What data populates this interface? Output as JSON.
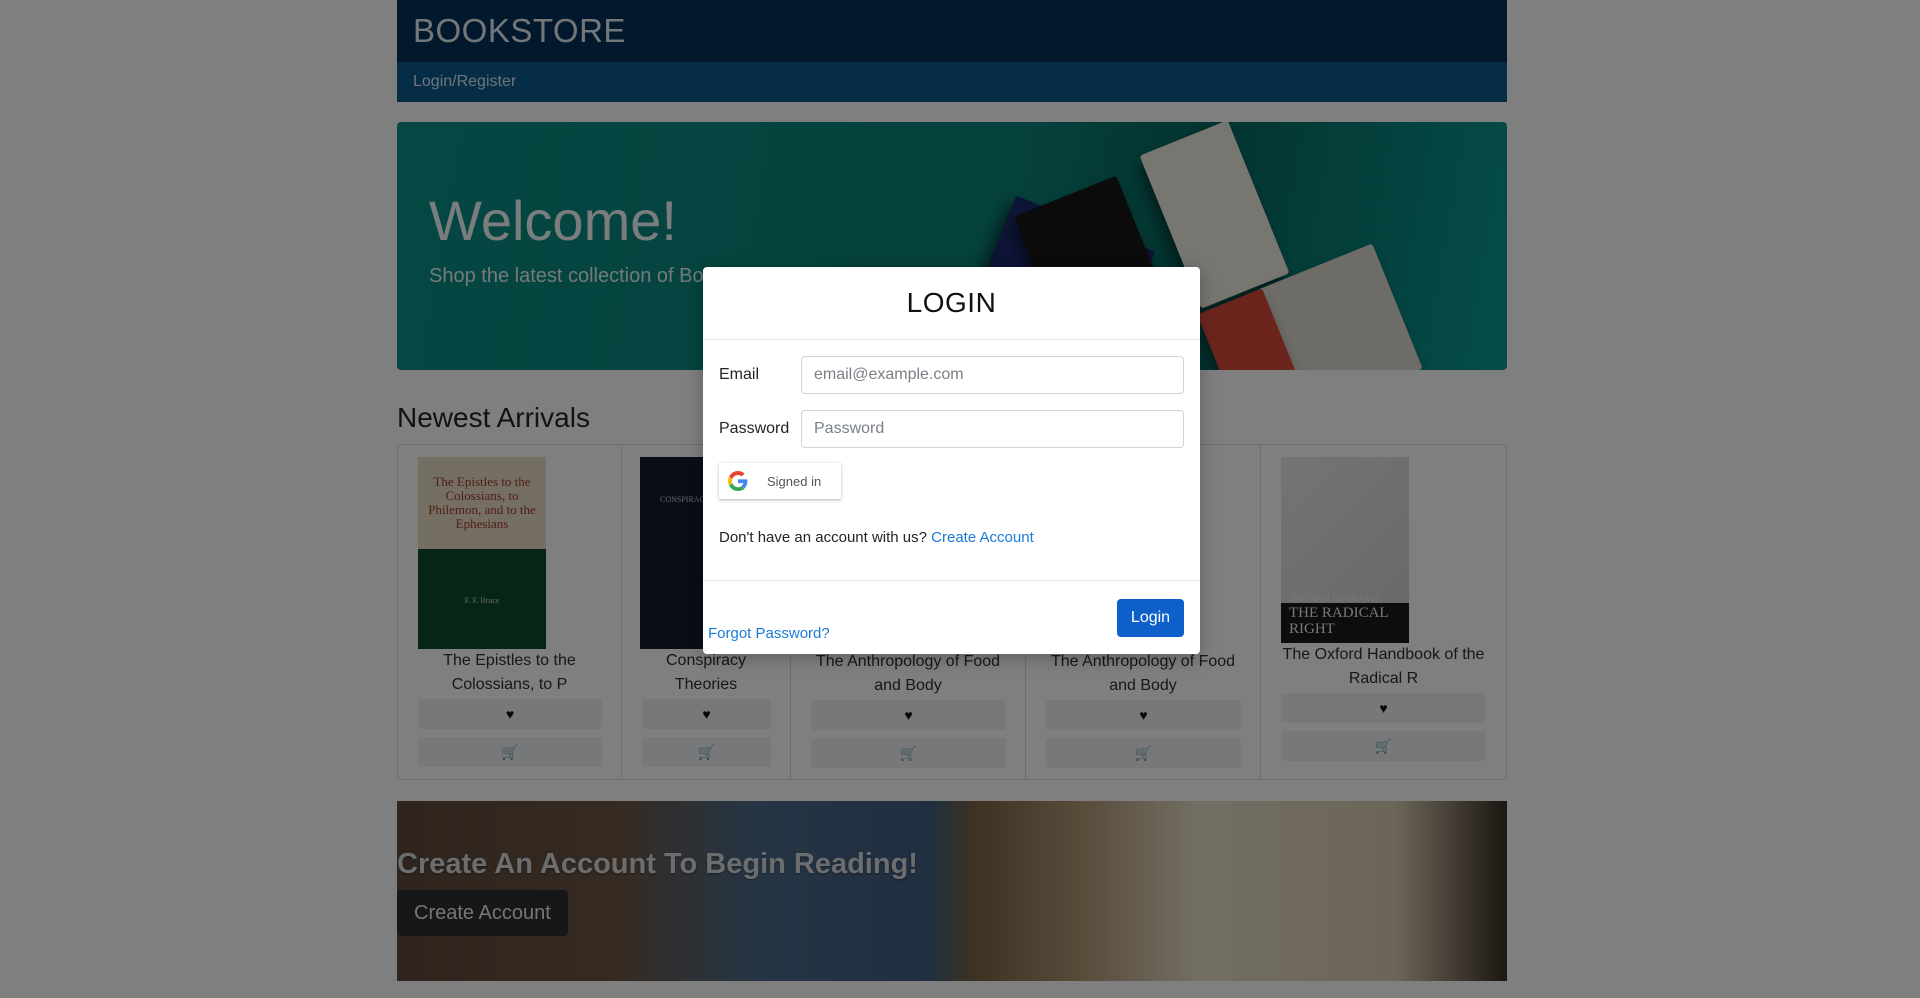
{
  "header": {
    "brand": "BOOKSTORE",
    "nav_login": "Login/Register"
  },
  "hero": {
    "title": "Welcome!",
    "subtitle": "Shop the latest collection of Books"
  },
  "arrivals": {
    "title": "Newest Arrivals",
    "books": [
      {
        "name": "The Epistles to the Colossians, to P",
        "cover_text": "The Epistles to the Colossians, to Philemon, and to the Ephesians",
        "cover_author": "F. F. Bruce"
      },
      {
        "name": "Conspiracy Theories",
        "cover_text": "CONSPIRACY",
        "cover_author": ""
      },
      {
        "name": "The Anthropology of Food and Body"
      },
      {
        "name": "The Anthropology of Food and Body"
      },
      {
        "name": "The Oxford Handbook of the Radical R",
        "cover_text": "THE RADICAL RIGHT",
        "cover_series": "The Oxford Handbook of"
      }
    ]
  },
  "banner": {
    "title": "Create An Account To Begin Reading!",
    "button": "Create Account"
  },
  "modal": {
    "title": "LOGIN",
    "email_label": "Email",
    "email_placeholder": "email@example.com",
    "password_label": "Password",
    "password_placeholder": "Password",
    "google_label": "Signed in",
    "signup_prompt": "Don't have an account with us?",
    "signup_link": "Create Account",
    "forgot_link": "Forgot Password?",
    "login_button": "Login"
  },
  "colors": {
    "brand": "#04325a",
    "nav": "#0d5a8c",
    "hero": "#0a8a82",
    "primary": "#0d5fc9",
    "link": "#1a7bd6"
  }
}
